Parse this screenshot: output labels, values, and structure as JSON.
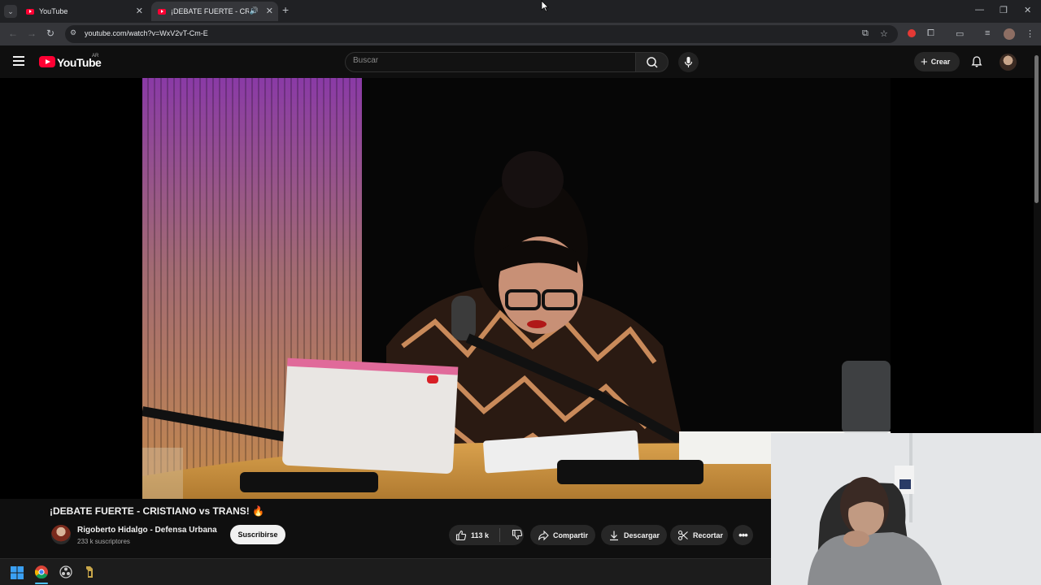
{
  "browser": {
    "tabs": [
      {
        "title": "YouTube",
        "active": false
      },
      {
        "title": "¡DEBATE FUERTE - CRISTIAN",
        "active": true
      }
    ],
    "url": "youtube.com/watch?v=WxV2vT-Cm-E"
  },
  "header": {
    "logo_text": "YouTube",
    "country_code": "AR",
    "search_placeholder": "Buscar",
    "create_label": "Crear"
  },
  "video": {
    "title": "¡DEBATE FUERTE - CRISTIANO vs TRANS! 🔥"
  },
  "channel": {
    "name": "Rigoberto Hidalgo - Defensa Urbana",
    "subscribers": "233 k suscriptores",
    "subscribe_label": "Suscribirse"
  },
  "actions": {
    "likes": "113 k",
    "share_label": "Compartir",
    "download_label": "Descargar",
    "clip_label": "Recortar"
  },
  "colors": {
    "accent": "#ff0033",
    "background": "#0f0f0f",
    "chrome_dark": "#202124",
    "chrome_toolbar": "#35363a"
  },
  "icons": [
    "menu-icon",
    "search-icon",
    "mic-icon",
    "bell-icon",
    "like-icon",
    "dislike-icon",
    "share-icon",
    "download-icon",
    "scissors-icon",
    "more-icon"
  ]
}
